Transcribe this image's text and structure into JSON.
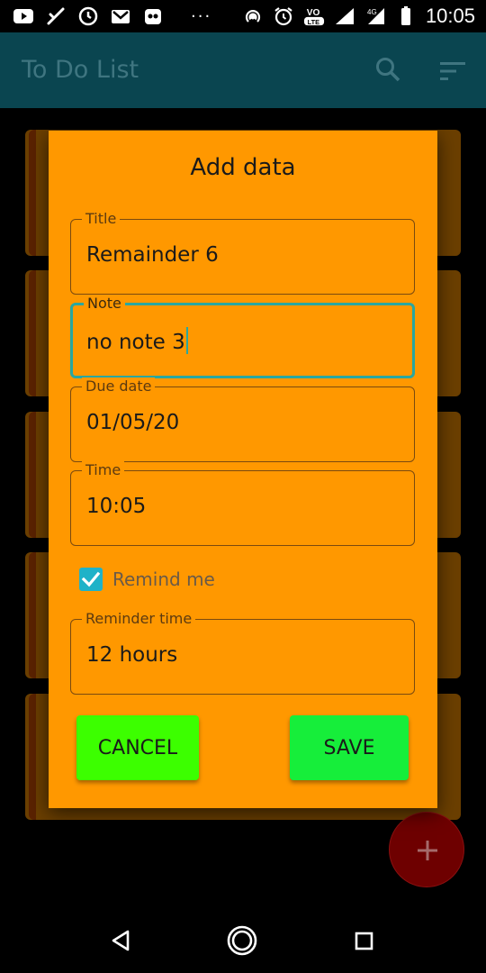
{
  "status_bar": {
    "time": "10:05",
    "dots": "···",
    "network": "4G",
    "volte": "VoLTE"
  },
  "app_bar": {
    "title": "To Do List"
  },
  "dialog": {
    "title": "Add data",
    "fields": [
      {
        "label": "Title",
        "value": "Remainder 6"
      },
      {
        "label": "Note",
        "value": "no note 3"
      },
      {
        "label": "Due date",
        "value": "01/05/20"
      },
      {
        "label": "Time",
        "value": "10:05"
      }
    ],
    "remind_me": {
      "label": "Remind me",
      "checked": true
    },
    "reminder_time": {
      "label": "Reminder time",
      "value": "12 hours"
    },
    "cancel_label": "CANCEL",
    "save_label": "SAVE"
  },
  "colors": {
    "dialog_bg": "#ff9800",
    "focus_accent": "#2aa7a0",
    "checkbox": "#1fb2c8",
    "button": "#3cff00",
    "app_bar": "#0a4550",
    "fab": "#6e0000"
  },
  "icons": {
    "status_left": [
      "youtube-icon",
      "notification-icon",
      "clock-icon",
      "gmail-icon",
      "app-icon"
    ],
    "status_right": [
      "hotspot-icon",
      "alarm-icon",
      "volte-icon",
      "wifi-icon",
      "signal-icon",
      "battery-icon"
    ],
    "app_bar": [
      "search-icon",
      "filter-icon"
    ],
    "nav": [
      "back-icon",
      "home-icon",
      "recents-icon"
    ],
    "fab": "add-icon"
  }
}
